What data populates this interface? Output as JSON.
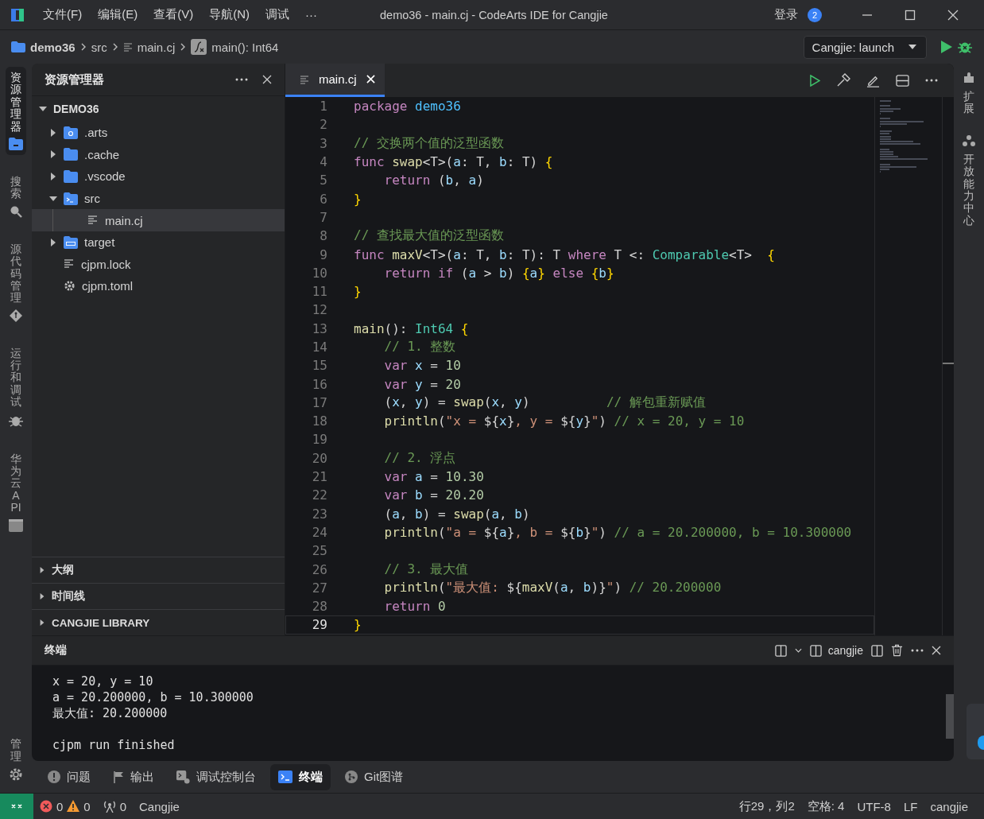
{
  "title_bar": {
    "menus": [
      "文件(F)",
      "编辑(E)",
      "查看(V)",
      "导航(N)",
      "调试"
    ],
    "more": "···",
    "title": "demo36 - main.cj - CodeArts IDE for Cangjie",
    "login": "登录",
    "badge": "2"
  },
  "breadcrumb": {
    "items": [
      {
        "kind": "folder",
        "label": "demo36"
      },
      {
        "kind": "plain",
        "label": "src"
      },
      {
        "kind": "file",
        "label": "main.cj"
      },
      {
        "kind": "function",
        "label": "main(): Int64"
      }
    ],
    "launch": "Cangjie: launch"
  },
  "activity_bar": {
    "items": [
      {
        "label": "资源管理器",
        "kind": "explorer",
        "selected": true
      },
      {
        "label": "搜索",
        "kind": "search",
        "selected": false
      },
      {
        "label": "源代码管理",
        "kind": "git",
        "selected": false
      },
      {
        "label": "运行和调试",
        "kind": "debug",
        "selected": false
      },
      {
        "label": "华为云 API",
        "kind": "api",
        "selected": false
      }
    ],
    "bottom": "管理"
  },
  "right_bar": {
    "items": [
      {
        "label": "扩展",
        "kind": "extensions"
      },
      {
        "label": "开放能力中心",
        "kind": "capability"
      }
    ]
  },
  "explorer": {
    "title": "资源管理器",
    "root": {
      "label": "DEMO36",
      "expanded": true,
      "children": [
        {
          "label": ".arts",
          "kind": "arts",
          "expanded": false,
          "selected": false
        },
        {
          "label": ".cache",
          "kind": "folder",
          "expanded": false,
          "selected": false
        },
        {
          "label": ".vscode",
          "kind": "folder",
          "expanded": false,
          "selected": false
        },
        {
          "label": "src",
          "kind": "source",
          "expanded": true,
          "selected": false,
          "children": [
            {
              "label": "main.cj",
              "kind": "file",
              "selected": true
            }
          ]
        },
        {
          "label": "target",
          "kind": "target",
          "expanded": false,
          "selected": false
        },
        {
          "label": "cjpm.lock",
          "kind": "file",
          "selected": false
        },
        {
          "label": "cjpm.toml",
          "kind": "config",
          "selected": false
        }
      ]
    },
    "sections": [
      {
        "label": "大纲",
        "expanded": false
      },
      {
        "label": "时间线",
        "expanded": false
      },
      {
        "label": "CANGJIE LIBRARY",
        "expanded": false
      }
    ]
  },
  "editor": {
    "tabs": [
      {
        "label": "main.cj",
        "selected": true
      }
    ],
    "lines": [
      {
        "n": "1",
        "current": false,
        "indented": false,
        "t": [
          {
            "kind": "kw",
            "text": "package "
          },
          {
            "kind": "ns",
            "text": "demo36"
          }
        ]
      },
      {
        "n": "2",
        "current": false,
        "indented": false
      },
      {
        "n": "3",
        "current": false,
        "indented": false,
        "t": [
          {
            "kind": "cm",
            "text": "// 交换两个值的泛型函数"
          }
        ]
      },
      {
        "n": "4",
        "current": false,
        "indented": false,
        "t": [
          {
            "kind": "kw",
            "text": "func "
          },
          {
            "kind": "fn",
            "text": "swap"
          },
          {
            "kind": "p",
            "text": "<T>("
          },
          {
            "kind": "v",
            "text": "a"
          },
          {
            "kind": "p",
            "text": ": T, "
          },
          {
            "kind": "v",
            "text": "b"
          },
          {
            "kind": "p",
            "text": ": T) "
          },
          {
            "kind": "br",
            "text": "{"
          }
        ]
      },
      {
        "n": "5",
        "current": false,
        "indented": true,
        "t": [
          {
            "kind": "kw",
            "text": "return "
          },
          {
            "kind": "p",
            "text": "("
          },
          {
            "kind": "v",
            "text": "b"
          },
          {
            "kind": "p",
            "text": ", "
          },
          {
            "kind": "v",
            "text": "a"
          },
          {
            "kind": "p",
            "text": ")"
          }
        ]
      },
      {
        "n": "6",
        "current": false,
        "indented": false,
        "t": [
          {
            "kind": "br",
            "text": "}"
          }
        ]
      },
      {
        "n": "7",
        "current": false,
        "indented": false
      },
      {
        "n": "8",
        "current": false,
        "indented": false,
        "t": [
          {
            "kind": "cm",
            "text": "// 查找最大值的泛型函数"
          }
        ]
      },
      {
        "n": "9",
        "current": false,
        "indented": false,
        "t": [
          {
            "kind": "kw",
            "text": "func "
          },
          {
            "kind": "fn",
            "text": "maxV"
          },
          {
            "kind": "p",
            "text": "<T>("
          },
          {
            "kind": "v",
            "text": "a"
          },
          {
            "kind": "p",
            "text": ": T, "
          },
          {
            "kind": "v",
            "text": "b"
          },
          {
            "kind": "p",
            "text": ": T): T "
          },
          {
            "kind": "kw",
            "text": "where "
          },
          {
            "kind": "p",
            "text": "T <: "
          },
          {
            "kind": "ty",
            "text": "Comparable"
          },
          {
            "kind": "p",
            "text": "<T>  "
          },
          {
            "kind": "br",
            "text": "{"
          }
        ]
      },
      {
        "n": "10",
        "current": false,
        "indented": true,
        "t": [
          {
            "kind": "kw",
            "text": "return if "
          },
          {
            "kind": "p",
            "text": "("
          },
          {
            "kind": "v",
            "text": "a"
          },
          {
            "kind": "p",
            "text": " > "
          },
          {
            "kind": "v",
            "text": "b"
          },
          {
            "kind": "p",
            "text": ") "
          },
          {
            "kind": "br",
            "text": "{"
          },
          {
            "kind": "v",
            "text": "a"
          },
          {
            "kind": "br",
            "text": "} "
          },
          {
            "kind": "kw",
            "text": "else "
          },
          {
            "kind": "br",
            "text": "{"
          },
          {
            "kind": "v",
            "text": "b"
          },
          {
            "kind": "br",
            "text": "}"
          }
        ]
      },
      {
        "n": "11",
        "current": false,
        "indented": false,
        "t": [
          {
            "kind": "br",
            "text": "}"
          }
        ]
      },
      {
        "n": "12",
        "current": false,
        "indented": false
      },
      {
        "n": "13",
        "current": false,
        "indented": false,
        "t": [
          {
            "kind": "fn",
            "text": "main"
          },
          {
            "kind": "p",
            "text": "(): "
          },
          {
            "kind": "ty",
            "text": "Int64 "
          },
          {
            "kind": "br",
            "text": "{"
          }
        ]
      },
      {
        "n": "14",
        "current": false,
        "indented": true,
        "t": [
          {
            "kind": "cm",
            "text": "// 1. 整数"
          }
        ]
      },
      {
        "n": "15",
        "current": false,
        "indented": true,
        "t": [
          {
            "kind": "kw",
            "text": "var "
          },
          {
            "kind": "v",
            "text": "x"
          },
          {
            "kind": "p",
            "text": " = "
          },
          {
            "kind": "num",
            "text": "10"
          }
        ]
      },
      {
        "n": "16",
        "current": false,
        "indented": true,
        "t": [
          {
            "kind": "kw",
            "text": "var "
          },
          {
            "kind": "v",
            "text": "y"
          },
          {
            "kind": "p",
            "text": " = "
          },
          {
            "kind": "num",
            "text": "20"
          }
        ]
      },
      {
        "n": "17",
        "current": false,
        "indented": true,
        "t": [
          {
            "kind": "p",
            "text": "("
          },
          {
            "kind": "v",
            "text": "x"
          },
          {
            "kind": "p",
            "text": ", "
          },
          {
            "kind": "v",
            "text": "y"
          },
          {
            "kind": "p",
            "text": ") = "
          },
          {
            "kind": "fn",
            "text": "swap"
          },
          {
            "kind": "p",
            "text": "("
          },
          {
            "kind": "v",
            "text": "x"
          },
          {
            "kind": "p",
            "text": ", "
          },
          {
            "kind": "v",
            "text": "y"
          },
          {
            "kind": "p",
            "text": ")          "
          },
          {
            "kind": "cm",
            "text": "// 解包重新赋值"
          }
        ]
      },
      {
        "n": "18",
        "current": false,
        "indented": true,
        "t": [
          {
            "kind": "fn",
            "text": "println"
          },
          {
            "kind": "p",
            "text": "("
          },
          {
            "kind": "str",
            "text": "\"x = "
          },
          {
            "kind": "p",
            "text": "${"
          },
          {
            "kind": "v",
            "text": "x"
          },
          {
            "kind": "p",
            "text": "}"
          },
          {
            "kind": "str",
            "text": ", y = "
          },
          {
            "kind": "p",
            "text": "${"
          },
          {
            "kind": "v",
            "text": "y"
          },
          {
            "kind": "p",
            "text": "}"
          },
          {
            "kind": "str",
            "text": "\""
          },
          {
            "kind": "p",
            "text": ") "
          },
          {
            "kind": "cm",
            "text": "// x = 20, y = 10"
          }
        ]
      },
      {
        "n": "19",
        "current": false,
        "indented": false
      },
      {
        "n": "20",
        "current": false,
        "indented": true,
        "t": [
          {
            "kind": "cm",
            "text": "// 2. 浮点"
          }
        ]
      },
      {
        "n": "21",
        "current": false,
        "indented": true,
        "t": [
          {
            "kind": "kw",
            "text": "var "
          },
          {
            "kind": "v",
            "text": "a"
          },
          {
            "kind": "p",
            "text": " = "
          },
          {
            "kind": "num",
            "text": "10.30"
          }
        ]
      },
      {
        "n": "22",
        "current": false,
        "indented": true,
        "t": [
          {
            "kind": "kw",
            "text": "var "
          },
          {
            "kind": "v",
            "text": "b"
          },
          {
            "kind": "p",
            "text": " = "
          },
          {
            "kind": "num",
            "text": "20.20"
          }
        ]
      },
      {
        "n": "23",
        "current": false,
        "indented": true,
        "t": [
          {
            "kind": "p",
            "text": "("
          },
          {
            "kind": "v",
            "text": "a"
          },
          {
            "kind": "p",
            "text": ", "
          },
          {
            "kind": "v",
            "text": "b"
          },
          {
            "kind": "p",
            "text": ") = "
          },
          {
            "kind": "fn",
            "text": "swap"
          },
          {
            "kind": "p",
            "text": "("
          },
          {
            "kind": "v",
            "text": "a"
          },
          {
            "kind": "p",
            "text": ", "
          },
          {
            "kind": "v",
            "text": "b"
          },
          {
            "kind": "p",
            "text": ")"
          }
        ]
      },
      {
        "n": "24",
        "current": false,
        "indented": true,
        "t": [
          {
            "kind": "fn",
            "text": "println"
          },
          {
            "kind": "p",
            "text": "("
          },
          {
            "kind": "str",
            "text": "\"a = "
          },
          {
            "kind": "p",
            "text": "${"
          },
          {
            "kind": "v",
            "text": "a"
          },
          {
            "kind": "p",
            "text": "}"
          },
          {
            "kind": "str",
            "text": ", b = "
          },
          {
            "kind": "p",
            "text": "${"
          },
          {
            "kind": "v",
            "text": "b"
          },
          {
            "kind": "p",
            "text": "}"
          },
          {
            "kind": "str",
            "text": "\""
          },
          {
            "kind": "p",
            "text": ") "
          },
          {
            "kind": "cm",
            "text": "// a = 20.200000, b = 10.300000"
          }
        ]
      },
      {
        "n": "25",
        "current": false,
        "indented": false
      },
      {
        "n": "26",
        "current": false,
        "indented": true,
        "t": [
          {
            "kind": "cm",
            "text": "// 3. 最大值"
          }
        ]
      },
      {
        "n": "27",
        "current": false,
        "indented": true,
        "t": [
          {
            "kind": "fn",
            "text": "println"
          },
          {
            "kind": "p",
            "text": "("
          },
          {
            "kind": "str",
            "text": "\"最大值: "
          },
          {
            "kind": "p",
            "text": "${"
          },
          {
            "kind": "fn",
            "text": "maxV"
          },
          {
            "kind": "p",
            "text": "("
          },
          {
            "kind": "v",
            "text": "a"
          },
          {
            "kind": "p",
            "text": ", "
          },
          {
            "kind": "v",
            "text": "b"
          },
          {
            "kind": "p",
            "text": ")}"
          },
          {
            "kind": "str",
            "text": "\""
          },
          {
            "kind": "p",
            "text": ") "
          },
          {
            "kind": "cm",
            "text": "// 20.200000"
          }
        ]
      },
      {
        "n": "28",
        "current": false,
        "indented": true,
        "t": [
          {
            "kind": "kw",
            "text": "return "
          },
          {
            "kind": "num",
            "text": "0"
          }
        ]
      },
      {
        "n": "29",
        "current": true,
        "indented": false,
        "t": [
          {
            "kind": "br",
            "text": "}"
          }
        ]
      }
    ]
  },
  "terminal": {
    "title": "终端",
    "shell": "cangjie",
    "lines": [
      "x = 20, y = 10",
      "a = 20.200000, b = 10.300000",
      "最大值: 20.200000"
    ],
    "finish_message": "cjpm run finished"
  },
  "panel_tabs": [
    {
      "label": "问题",
      "kind": "problems",
      "selected": false
    },
    {
      "label": "输出",
      "kind": "output",
      "selected": false
    },
    {
      "label": "调试控制台",
      "kind": "console",
      "selected": false
    },
    {
      "label": "终端",
      "kind": "terminal",
      "selected": true
    },
    {
      "label": "Git图谱",
      "kind": "graph",
      "selected": false
    }
  ],
  "status_bar": {
    "errors": "0",
    "warnings": "0",
    "ports": "0",
    "language": "Cangjie",
    "right": [
      "行29，列2",
      "空格: 4",
      "UTF-8",
      "LF",
      "cangjie"
    ]
  }
}
